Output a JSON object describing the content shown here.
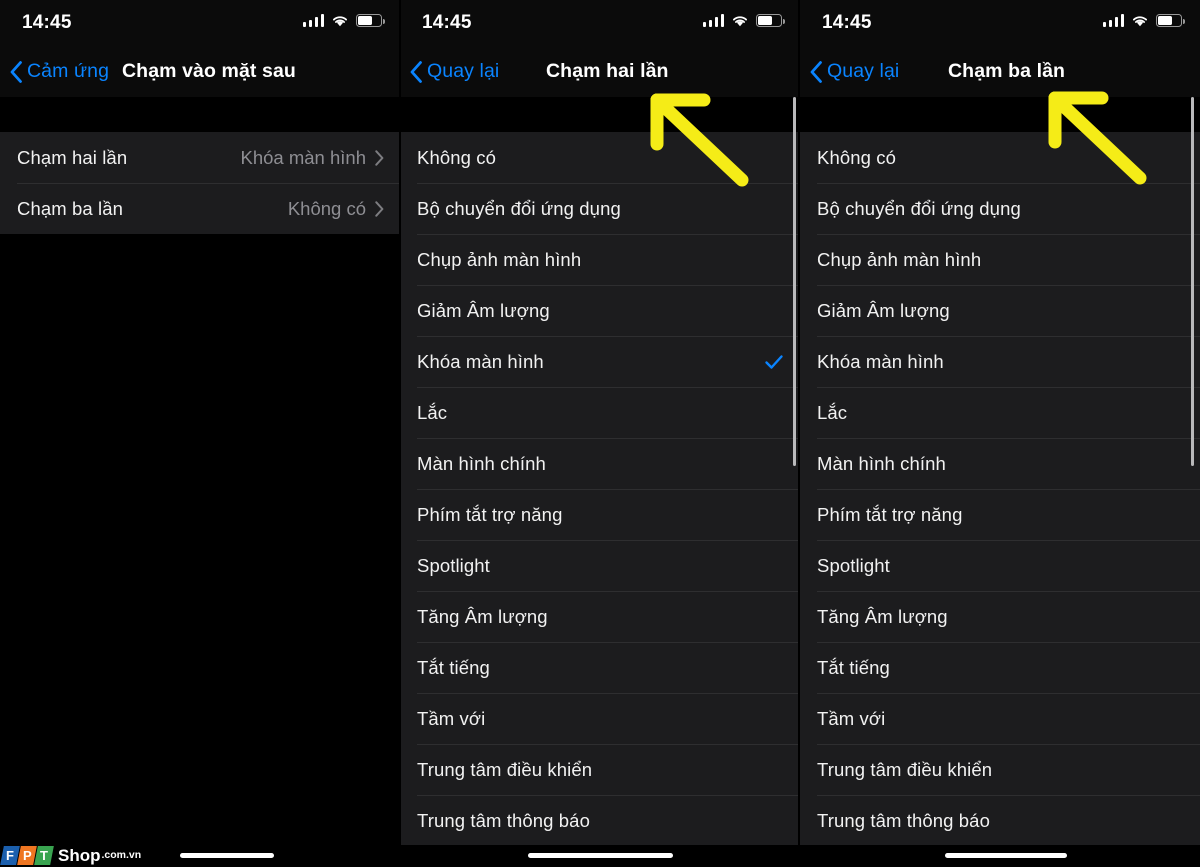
{
  "status_bar": {
    "time": "14:45",
    "signal_icon": "cellular-signal-icon",
    "wifi_icon": "wifi-icon",
    "battery_icon": "battery-icon"
  },
  "colors": {
    "accent_blue": "#0a84ff",
    "list_background": "#1c1c1e",
    "separator": "#2e2e30",
    "value_gray": "#8e8e93",
    "annotation_yellow": "#f5ec17",
    "scrollbar": "#b9b9bb"
  },
  "panels": [
    {
      "id": "back-tap-settings",
      "nav": {
        "back_label": "Cảm ứng",
        "back_icon": "chevron-left-icon",
        "title": "Chạm vào mặt sau"
      },
      "rows": [
        {
          "label": "Chạm hai lần",
          "value": "Khóa màn hình",
          "disclosure_icon": "chevron-right-icon"
        },
        {
          "label": "Chạm ba lần",
          "value": "Không có",
          "disclosure_icon": "chevron-right-icon"
        }
      ]
    },
    {
      "id": "double-tap-actions",
      "nav": {
        "back_label": "Quay lại",
        "back_icon": "chevron-left-icon",
        "title": "Chạm hai lần"
      },
      "rows": [
        {
          "label": "Không có",
          "selected": false
        },
        {
          "label": "Bộ chuyển đổi ứng dụng",
          "selected": false
        },
        {
          "label": "Chụp ảnh màn hình",
          "selected": false
        },
        {
          "label": "Giảm Âm lượng",
          "selected": false
        },
        {
          "label": "Khóa màn hình",
          "selected": true
        },
        {
          "label": "Lắc",
          "selected": false
        },
        {
          "label": "Màn hình chính",
          "selected": false
        },
        {
          "label": "Phím tắt trợ năng",
          "selected": false
        },
        {
          "label": "Spotlight",
          "selected": false
        },
        {
          "label": "Tăng Âm lượng",
          "selected": false
        },
        {
          "label": "Tắt tiếng",
          "selected": false
        },
        {
          "label": "Tầm với",
          "selected": false
        },
        {
          "label": "Trung tâm điều khiển",
          "selected": false
        },
        {
          "label": "Trung tâm thông báo",
          "selected": false
        }
      ]
    },
    {
      "id": "triple-tap-actions",
      "nav": {
        "back_label": "Quay lại",
        "back_icon": "chevron-left-icon",
        "title": "Chạm ba lần"
      },
      "rows": [
        {
          "label": "Không có",
          "selected": false
        },
        {
          "label": "Bộ chuyển đổi ứng dụng",
          "selected": false
        },
        {
          "label": "Chụp ảnh màn hình",
          "selected": false
        },
        {
          "label": "Giảm Âm lượng",
          "selected": false
        },
        {
          "label": "Khóa màn hình",
          "selected": false
        },
        {
          "label": "Lắc",
          "selected": false
        },
        {
          "label": "Màn hình chính",
          "selected": false
        },
        {
          "label": "Phím tắt trợ năng",
          "selected": false
        },
        {
          "label": "Spotlight",
          "selected": false
        },
        {
          "label": "Tăng Âm lượng",
          "selected": false
        },
        {
          "label": "Tắt tiếng",
          "selected": false
        },
        {
          "label": "Tầm với",
          "selected": false
        },
        {
          "label": "Trung tâm điều khiển",
          "selected": false
        },
        {
          "label": "Trung tâm thông báo",
          "selected": false
        }
      ]
    }
  ],
  "annotations": [
    {
      "name": "arrow-pointing-to-double-tap-title",
      "icon": "arrow-up-left-icon"
    },
    {
      "name": "arrow-pointing-to-triple-tap-title",
      "icon": "arrow-up-left-icon"
    }
  ],
  "watermark": {
    "letters": [
      "F",
      "P",
      "T"
    ],
    "name": "Shop",
    "tld": ".com.vn"
  }
}
